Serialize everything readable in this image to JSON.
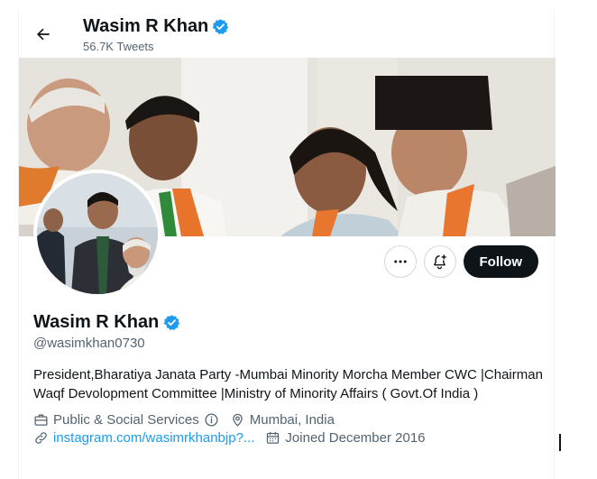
{
  "header": {
    "name": "Wasim R Khan",
    "tweet_count": "56.7K Tweets"
  },
  "profile": {
    "display_name": "Wasim R Khan",
    "handle": "@wasimkhan0730",
    "bio": "President,Bharatiya Janata Party -Mumbai Minority Morcha Member CWC |Chairman Waqf Devolopment Committee |Ministry of Minority Affairs ( Govt.Of India )",
    "category": "Public & Social Services",
    "location": "Mumbai, India",
    "website": "instagram.com/wasimrkhanbjp?...",
    "joined": "Joined December 2016",
    "verified": true
  },
  "actions": {
    "follow_label": "Follow"
  },
  "icons": {
    "back": "arrow-left-icon",
    "verified": "verified-badge-icon",
    "more": "more-dots-icon",
    "notify": "bell-plus-icon",
    "category": "briefcase-icon",
    "info": "info-icon",
    "location": "location-pin-icon",
    "link": "link-icon",
    "calendar": "calendar-icon"
  },
  "colors": {
    "verified": "#1d9bf0",
    "link": "#1d9bf0",
    "follow_bg": "#0f1419",
    "secondary_text": "#536471"
  }
}
